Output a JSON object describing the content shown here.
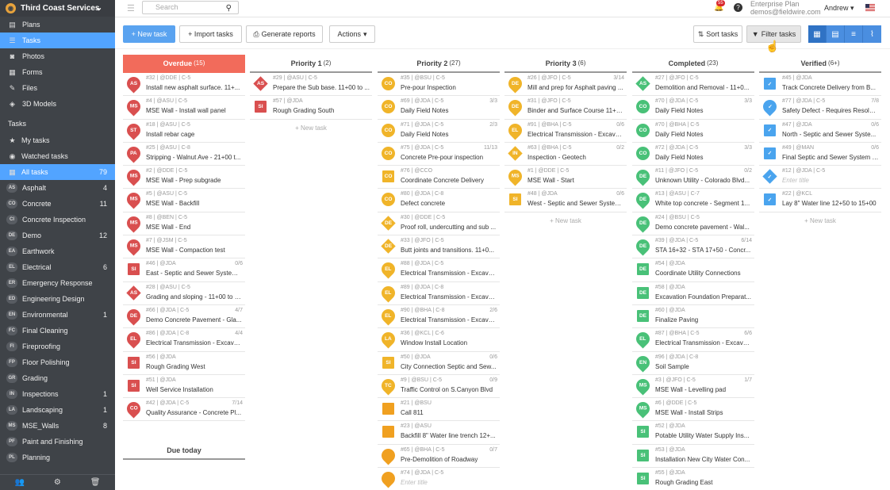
{
  "colors": {
    "overdue": "#f26b5b",
    "priority": "#f0b429",
    "completed": "#49c178",
    "verified": "#4aa4ee",
    "accent": "#52a4ff",
    "asphalt": "#d94f4f"
  },
  "sidebar": {
    "org": "Third Coast Services",
    "nav": [
      {
        "label": "Plans",
        "icon": "plans-icon",
        "glyph": "▤"
      },
      {
        "label": "Tasks",
        "icon": "tasks-icon",
        "glyph": "☰",
        "active": true
      },
      {
        "label": "Photos",
        "icon": "camera-icon",
        "glyph": "◙"
      },
      {
        "label": "Forms",
        "icon": "forms-icon",
        "glyph": "▦"
      },
      {
        "label": "Files",
        "icon": "files-icon",
        "glyph": "✎"
      },
      {
        "label": "3D Models",
        "icon": "cube-icon",
        "glyph": "◈"
      }
    ],
    "section": "Tasks",
    "filters": [
      {
        "label": "My tasks",
        "icon": "star-icon",
        "glyph": "★"
      },
      {
        "label": "Watched tasks",
        "icon": "eye-icon",
        "glyph": "◉"
      },
      {
        "label": "All tasks",
        "icon": "grid-icon",
        "glyph": "▦",
        "count": "79",
        "active": true
      }
    ],
    "categories": [
      {
        "code": "AS",
        "label": "Asphalt",
        "count": "4"
      },
      {
        "code": "CO",
        "label": "Concrete",
        "count": "11"
      },
      {
        "code": "CI",
        "label": "Concrete Inspection",
        "count": ""
      },
      {
        "code": "DE",
        "label": "Demo",
        "count": "12"
      },
      {
        "code": "EA",
        "label": "Earthwork",
        "count": ""
      },
      {
        "code": "EL",
        "label": "Electrical",
        "count": "6"
      },
      {
        "code": "ER",
        "label": "Emergency Response",
        "count": ""
      },
      {
        "code": "ED",
        "label": "Engineering Design",
        "count": ""
      },
      {
        "code": "EN",
        "label": "Environmental",
        "count": "1"
      },
      {
        "code": "FC",
        "label": "Final Cleaning",
        "count": ""
      },
      {
        "code": "FI",
        "label": "Fireproofing",
        "count": ""
      },
      {
        "code": "FP",
        "label": "Floor Polishing",
        "count": ""
      },
      {
        "code": "GR",
        "label": "Grading",
        "count": ""
      },
      {
        "code": "IN",
        "label": "Inspections",
        "count": "1"
      },
      {
        "code": "LA",
        "label": "Landscaping",
        "count": "1"
      },
      {
        "code": "MS",
        "label": "MSE_Walls",
        "count": "8"
      },
      {
        "code": "PF",
        "label": "Paint and Finishing",
        "count": ""
      },
      {
        "code": "PL",
        "label": "Planning",
        "count": ""
      }
    ]
  },
  "topbar": {
    "search_placeholder": "Search",
    "notifications": "55",
    "plan": "Enterprise Plan",
    "email": "demos@fieldwire.com",
    "user": "Andrew"
  },
  "toolbar": {
    "new_task": "+ New task",
    "import": "+ Import tasks",
    "reports": "Generate reports",
    "actions": "Actions",
    "sort": "Sort tasks",
    "filter": "Filter tasks"
  },
  "columns": [
    {
      "title": "Overdue",
      "count": "(15)",
      "style": "overdue",
      "tasks": [
        {
          "code": "AS",
          "shape": "pin",
          "color": "#d94f4f",
          "meta": "#32 | @DDE | C-5",
          "title": "Install new asphalt surface. 11+..."
        },
        {
          "code": "MS",
          "shape": "pin",
          "color": "#d94f4f",
          "meta": "#4 | @ASU | C-5",
          "title": "MSE Wall - Install wall panel"
        },
        {
          "code": "ST",
          "shape": "pin",
          "color": "#d94f4f",
          "meta": "#18 | @ASU | C-5",
          "title": "Install rebar cage"
        },
        {
          "code": "PA",
          "shape": "pin",
          "color": "#d94f4f",
          "meta": "#25 | @ASU | C-8",
          "title": "Stripping - Walnut Ave - 21+00 t..."
        },
        {
          "code": "MS",
          "shape": "pin",
          "color": "#d94f4f",
          "meta": "#2 | @DDE | C-5",
          "title": "MSE Wall - Prep subgrade"
        },
        {
          "code": "MS",
          "shape": "pin",
          "color": "#d94f4f",
          "meta": "#5 | @ASU | C-5",
          "title": "MSE Wall - Backfill"
        },
        {
          "code": "MS",
          "shape": "pin",
          "color": "#d94f4f",
          "meta": "#8 | @BEN | C-5",
          "title": "MSE Wall - End"
        },
        {
          "code": "MS",
          "shape": "pin",
          "color": "#d94f4f",
          "meta": "#7 | @JSM | C-5",
          "title": "MSE Wall - Compaction test"
        },
        {
          "code": "SI",
          "shape": "square",
          "color": "#d94f4f",
          "meta": "#46 | @JDA",
          "prog": "0/6",
          "title": "East - Septic and Sewer System I..."
        },
        {
          "code": "AS",
          "shape": "diamond",
          "color": "#d94f4f",
          "meta": "#28 | @ASU | C-5",
          "title": "Grading and sloping - 11+00 to 1..."
        },
        {
          "code": "DE",
          "shape": "pin",
          "color": "#d94f4f",
          "meta": "#66 | @JDA | C-5",
          "prog": "4/7",
          "title": "Demo Concrete Pavement - Gla..."
        },
        {
          "code": "EL",
          "shape": "pin",
          "color": "#d94f4f",
          "meta": "#86 | @JDA | C-8",
          "prog": "4/4",
          "title": "Electrical Transmission - Excavat..."
        },
        {
          "code": "SI",
          "shape": "square",
          "color": "#d94f4f",
          "meta": "#56 | @JDA",
          "title": "Rough Grading West"
        },
        {
          "code": "SI",
          "shape": "square",
          "color": "#d94f4f",
          "meta": "#51 | @JDA",
          "title": "Well Service Installation"
        },
        {
          "code": "CO",
          "shape": "pin",
          "color": "#d94f4f",
          "meta": "#42 | @JDA | C-5",
          "prog": "7/14",
          "title": "Quality Assurance - Concrete Pl..."
        }
      ],
      "due": "Due today"
    },
    {
      "title": "Priority 1",
      "count": "(2)",
      "style": "normal",
      "tasks": [
        {
          "code": "AS",
          "shape": "diamond",
          "color": "#d94f4f",
          "meta": "#29 | @ASU | C-5",
          "title": "Prepare the Sub base. 11+00 to ..."
        },
        {
          "code": "SI",
          "shape": "square",
          "color": "#d94f4f",
          "meta": "#57 | @JDA",
          "title": "Rough Grading South"
        }
      ],
      "new": "+ New task"
    },
    {
      "title": "Priority 2",
      "count": "(27)",
      "style": "normal",
      "tasks": [
        {
          "code": "CO",
          "shape": "circle",
          "color": "#f0b429",
          "meta": "#35 | @BSU | C-5",
          "title": "Pre-pour Inspection"
        },
        {
          "code": "CO",
          "shape": "circle",
          "color": "#f0b429",
          "meta": "#69 | @JDA | C-5",
          "prog": "3/3",
          "title": "Daily Field Notes"
        },
        {
          "code": "CO",
          "shape": "circle",
          "color": "#f0b429",
          "meta": "#71 | @JDA | C-5",
          "prog": "2/3",
          "title": "Daily Field Notes"
        },
        {
          "code": "CO",
          "shape": "circle",
          "color": "#f0b429",
          "meta": "#75 | @JDA | C-5",
          "prog": "11/13",
          "title": "Concrete Pre-pour inspection"
        },
        {
          "code": "CO",
          "shape": "square",
          "color": "#f0b429",
          "meta": "#76 | @CCO",
          "title": "Coordinate Concrete Delivery"
        },
        {
          "code": "CO",
          "shape": "circle",
          "color": "#f0b429",
          "meta": "#80 | @JDA | C-8",
          "title": "Defect concrete"
        },
        {
          "code": "DE",
          "shape": "diamond",
          "color": "#f0b429",
          "meta": "#30 | @DDE | C-5",
          "title": "Proof roll, undercutting and sub ..."
        },
        {
          "code": "DE",
          "shape": "diamond",
          "color": "#f0b429",
          "meta": "#33 | @JFO | C-5",
          "title": "Butt joints and transitions. 11+0..."
        },
        {
          "code": "EL",
          "shape": "pin",
          "color": "#f0b429",
          "meta": "#88 | @JDA | C-5",
          "title": "Electrical Transmission - Excavat..."
        },
        {
          "code": "EL",
          "shape": "pin",
          "color": "#f0b429",
          "meta": "#89 | @JDA | C-8",
          "title": "Electrical Transmission - Excavat..."
        },
        {
          "code": "EL",
          "shape": "pin",
          "color": "#f0b429",
          "meta": "#90 | @BHA | C-8",
          "prog": "2/6",
          "title": "Electrical Transmission - Excavat..."
        },
        {
          "code": "LA",
          "shape": "pin",
          "color": "#f0b429",
          "meta": "#36 | @KCL | C-6",
          "title": "Window Install Location"
        },
        {
          "code": "SI",
          "shape": "square",
          "color": "#f0b429",
          "meta": "#50 | @JDA",
          "prog": "0/6",
          "title": "City Connection Septic and Sew..."
        },
        {
          "code": "TC",
          "shape": "pin",
          "color": "#f0b429",
          "meta": "#9 | @BSU | C-5",
          "prog": "0/9",
          "title": "Traffic Control on S.Canyon Blvd"
        },
        {
          "code": "",
          "shape": "square",
          "color": "#f0a020",
          "meta": "#21 | @BSU",
          "title": "Call 811"
        },
        {
          "code": "",
          "shape": "square",
          "color": "#f0a020",
          "meta": "#23 | @ASU",
          "title": "Backfill 8\" Water line trench 12+..."
        },
        {
          "code": "",
          "shape": "pin",
          "color": "#f0a020",
          "meta": "#65 | @BHA | C-5",
          "prog": "0/7",
          "title": "Pre-Demolition of Roadway"
        },
        {
          "code": "",
          "shape": "pin",
          "color": "#f0a020",
          "meta": "#74 | @JDA | C-5",
          "title": "Enter title",
          "placeholder": true
        }
      ]
    },
    {
      "title": "Priority 3",
      "count": "(6)",
      "style": "normal",
      "tasks": [
        {
          "code": "DE",
          "shape": "pin",
          "color": "#f0b429",
          "meta": "#26 | @JFO | C-5",
          "prog": "3/14",
          "title": "Mill and prep for Asphalt paving ..."
        },
        {
          "code": "DE",
          "shape": "pin",
          "color": "#f0b429",
          "meta": "#31 | @JFO | C-5",
          "title": "Binder and Surface Course 11+0..."
        },
        {
          "code": "EL",
          "shape": "pin",
          "color": "#f0b429",
          "meta": "#91 | @BHA | C-5",
          "prog": "0/6",
          "title": "Electrical Transmission - Excavat..."
        },
        {
          "code": "IN",
          "shape": "diamond",
          "color": "#f0b429",
          "meta": "#63 | @BHA | C-5",
          "prog": "0/2",
          "title": "Inspection - Geotech"
        },
        {
          "code": "MS",
          "shape": "pin",
          "color": "#f0b429",
          "meta": "#1 | @DDE | C-5",
          "title": "MSE Wall - Start"
        },
        {
          "code": "SI",
          "shape": "square",
          "color": "#f0b429",
          "meta": "#48 | @JDA",
          "prog": "0/6",
          "title": "West - Septic and Sewer System ..."
        }
      ],
      "new": "+ New task"
    },
    {
      "title": "Completed",
      "count": "(23)",
      "style": "normal",
      "tasks": [
        {
          "code": "AS",
          "shape": "diamond",
          "color": "#49c178",
          "meta": "#27 | @JFO | C-5",
          "title": "Demolition and Removal - 11+0..."
        },
        {
          "code": "CO",
          "shape": "circle",
          "color": "#49c178",
          "meta": "#70 | @JDA | C-5",
          "prog": "3/3",
          "title": "Daily Field Notes"
        },
        {
          "code": "CO",
          "shape": "circle",
          "color": "#49c178",
          "meta": "#70 | @BHA | C-5",
          "title": "Daily Field Notes"
        },
        {
          "code": "CO",
          "shape": "circle",
          "color": "#49c178",
          "meta": "#72 | @JDA | C-5",
          "prog": "3/3",
          "title": "Daily Field Notes"
        },
        {
          "code": "DE",
          "shape": "pin",
          "color": "#49c178",
          "meta": "#11 | @JFO | C-5",
          "prog": "0/2",
          "title": "Unknown Utility - Colorado Blvd..."
        },
        {
          "code": "DE",
          "shape": "pin",
          "color": "#49c178",
          "meta": "#13 | @ASU | C-7",
          "title": "White top concrete - Segment 1..."
        },
        {
          "code": "DE",
          "shape": "pin",
          "color": "#49c178",
          "meta": "#24 | @BSU | C-5",
          "title": "Demo concrete pavement - Wal..."
        },
        {
          "code": "DE",
          "shape": "pin",
          "color": "#49c178",
          "meta": "#39 | @JDA | C-5",
          "prog": "6/14",
          "title": "STA 16+32 - STA 17+50 - Concr..."
        },
        {
          "code": "DE",
          "shape": "square",
          "color": "#49c178",
          "meta": "#54 | @JDA",
          "title": "Coordinate Utility Connections"
        },
        {
          "code": "DE",
          "shape": "square",
          "color": "#49c178",
          "meta": "#58 | @JDA",
          "title": "Excavation Foundation Preparat..."
        },
        {
          "code": "DE",
          "shape": "square",
          "color": "#49c178",
          "meta": "#60 | @JDA",
          "title": "Finalize Paving"
        },
        {
          "code": "EL",
          "shape": "pin",
          "color": "#49c178",
          "meta": "#87 | @BHA | C-5",
          "prog": "6/6",
          "title": "Electrical Transmission - Excavat..."
        },
        {
          "code": "EN",
          "shape": "pin",
          "color": "#49c178",
          "meta": "#96 | @JDA | C-8",
          "title": "Soil Sample"
        },
        {
          "code": "MS",
          "shape": "pin",
          "color": "#49c178",
          "meta": "#3 | @JFO | C-5",
          "prog": "1/7",
          "title": "MSE Wall - Levelling pad"
        },
        {
          "code": "MS",
          "shape": "pin",
          "color": "#49c178",
          "meta": "#6 | @DDE | C-5",
          "title": "MSE Wall - Install Strips"
        },
        {
          "code": "SI",
          "shape": "square",
          "color": "#49c178",
          "meta": "#52 | @JDA",
          "title": "Potable Utility Water Supply Ins..."
        },
        {
          "code": "SI",
          "shape": "square",
          "color": "#49c178",
          "meta": "#53 | @JDA",
          "title": "Installation New City Water Con..."
        },
        {
          "code": "SI",
          "shape": "square",
          "color": "#49c178",
          "meta": "#55 | @JDA",
          "title": "Rough Grading East"
        }
      ]
    },
    {
      "title": "Verified",
      "count": "(6+)",
      "style": "normal",
      "tasks": [
        {
          "code": "",
          "shape": "check",
          "color": "#4aa4ee",
          "meta": "#45 | @JDA",
          "title": "Track Concrete Delivery from B..."
        },
        {
          "code": "",
          "shape": "checkpin",
          "color": "#4aa4ee",
          "meta": "#77 | @JDA | C-5",
          "prog": "7/8",
          "title": "Safety Defect - Requires Resolut..."
        },
        {
          "code": "",
          "shape": "check",
          "color": "#4aa4ee",
          "meta": "#47 | @JDA",
          "prog": "0/6",
          "title": "North - Septic and Sewer Syste..."
        },
        {
          "code": "",
          "shape": "check",
          "color": "#4aa4ee",
          "meta": "#49 | @MAN",
          "prog": "0/6",
          "title": "Final Septic and Sewer System I..."
        },
        {
          "code": "",
          "shape": "checkdia",
          "color": "#4aa4ee",
          "meta": "#12 | @JDA | C-5",
          "title": "Enter title",
          "placeholder": true
        },
        {
          "code": "",
          "shape": "check",
          "color": "#4aa4ee",
          "meta": "#22 | @KCL",
          "title": "Lay 8\" Water line 12+50 to 15+00"
        }
      ],
      "new": "+ New task"
    }
  ]
}
